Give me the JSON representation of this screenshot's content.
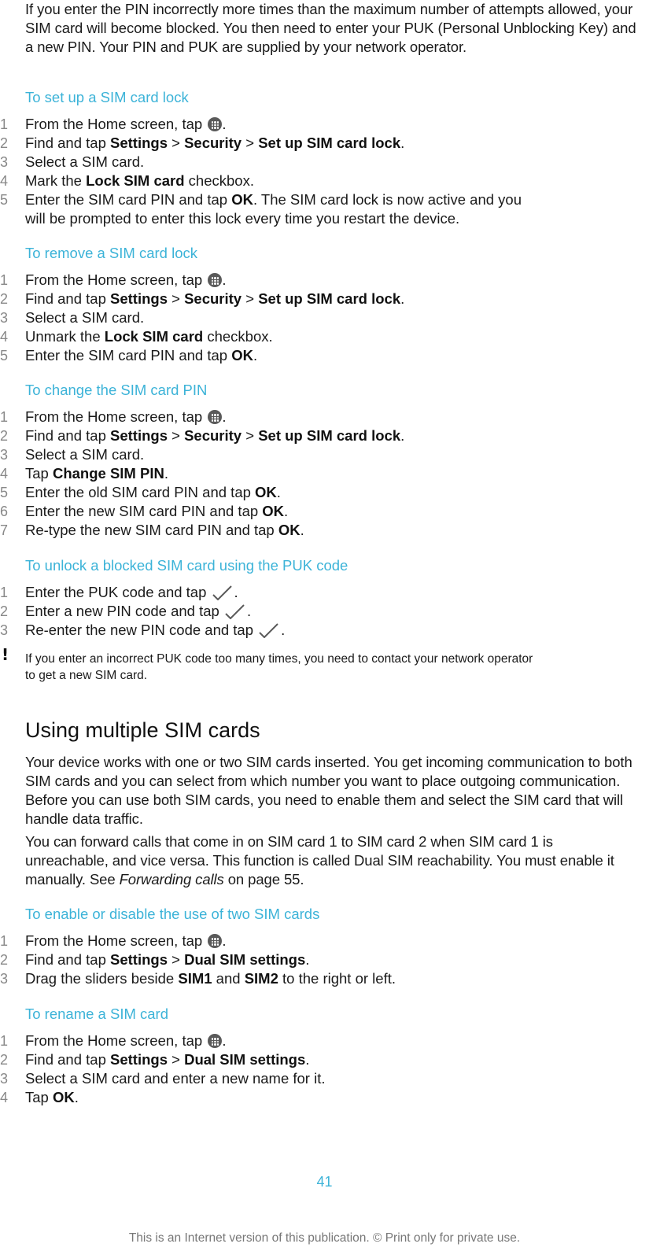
{
  "intro": "If you enter the PIN incorrectly more times than the maximum number of attempts allowed, your SIM card will become blocked. You then need to enter your PUK (Personal Unblocking Key) and a new PIN. Your PIN and PUK are supplied by your network operator.",
  "procedures": {
    "setup_lock": {
      "title": "To set up a SIM card lock",
      "steps": [
        {
          "num": "1",
          "pre": "From the Home screen, tap ",
          "icon": "app-screen-icon",
          "post": "."
        },
        {
          "num": "2",
          "pre": "Find and tap ",
          "b1": "Settings",
          "sep1": " > ",
          "b2": "Security",
          "sep2": " > ",
          "b3": "Set up SIM card lock",
          "post": "."
        },
        {
          "num": "3",
          "text": "Select a SIM card."
        },
        {
          "num": "4",
          "pre": "Mark the ",
          "b1": "Lock SIM card",
          "post": " checkbox."
        },
        {
          "num": "5",
          "pre": "Enter the SIM card PIN and tap ",
          "b1": "OK",
          "post": ". The SIM card lock is now active and you",
          "line2": "will be prompted to enter this lock every time you restart the device."
        }
      ]
    },
    "remove_lock": {
      "title": "To remove a SIM card lock",
      "steps": [
        {
          "num": "1",
          "pre": "From the Home screen, tap ",
          "icon": "app-screen-icon",
          "post": "."
        },
        {
          "num": "2",
          "pre": "Find and tap ",
          "b1": "Settings",
          "sep1": " > ",
          "b2": "Security",
          "sep2": " > ",
          "b3": "Set up SIM card lock",
          "post": "."
        },
        {
          "num": "3",
          "text": "Select a SIM card."
        },
        {
          "num": "4",
          "pre": "Unmark the ",
          "b1": "Lock SIM card",
          "post": " checkbox."
        },
        {
          "num": "5",
          "pre": "Enter the SIM card PIN and tap ",
          "b1": "OK",
          "post": "."
        }
      ]
    },
    "change_pin": {
      "title": "To change the SIM card PIN",
      "steps": [
        {
          "num": "1",
          "pre": "From the Home screen, tap ",
          "icon": "app-screen-icon",
          "post": "."
        },
        {
          "num": "2",
          "pre": "Find and tap ",
          "b1": "Settings",
          "sep1": " > ",
          "b2": "Security",
          "sep2": " > ",
          "b3": "Set up SIM card lock",
          "post": "."
        },
        {
          "num": "3",
          "text": "Select a SIM card."
        },
        {
          "num": "4",
          "pre": "Tap ",
          "b1": "Change SIM PIN",
          "post": "."
        },
        {
          "num": "5",
          "pre": "Enter the old SIM card PIN and tap ",
          "b1": "OK",
          "post": "."
        },
        {
          "num": "6",
          "pre": "Enter the new SIM card PIN and tap ",
          "b1": "OK",
          "post": "."
        },
        {
          "num": "7",
          "pre": "Re-type the new SIM card PIN and tap ",
          "b1": "OK",
          "post": "."
        }
      ]
    },
    "unlock_puk": {
      "title": "To unlock a blocked SIM card using the PUK code",
      "steps": [
        {
          "num": "1",
          "pre": "Enter the PUK code and tap ",
          "icon": "checkmark-icon",
          "post": "."
        },
        {
          "num": "2",
          "pre": "Enter a new PIN code and tap ",
          "icon": "checkmark-icon",
          "post": "."
        },
        {
          "num": "3",
          "pre": "Re-enter the new PIN code and tap ",
          "icon": "checkmark-icon",
          "post": "."
        }
      ]
    }
  },
  "note": {
    "icon": "!",
    "line1": "If you enter an incorrect PUK code too many times, you need to contact your network operator",
    "line2": "to get a new SIM card."
  },
  "section": {
    "heading": "Using multiple SIM cards",
    "para1": "Your device works with one or two SIM cards inserted. You get incoming communication to both SIM cards and you can select from which number you want to place outgoing communication. Before you can use both SIM cards, you need to enable them and select the SIM card that will handle data traffic.",
    "para2_pre": "You can forward calls that come in on SIM card 1 to SIM card 2 when SIM card 1 is unreachable, and vice versa. This function is called Dual SIM reachability. You must enable it manually. See ",
    "para2_link": "Forwarding calls",
    "para2_post": " on page 55."
  },
  "procedures2": {
    "enable_two": {
      "title": "To enable or disable the use of two SIM cards",
      "steps": [
        {
          "num": "1",
          "pre": "From the Home screen, tap ",
          "icon": "app-screen-icon",
          "post": "."
        },
        {
          "num": "2",
          "pre": "Find and tap ",
          "b1": "Settings",
          "sep1": " > ",
          "b2": "Dual SIM settings",
          "post": "."
        },
        {
          "num": "3",
          "pre": "Drag the sliders beside ",
          "b1": "SIM1",
          "mid": " and ",
          "b2": "SIM2",
          "post": " to the right or left."
        }
      ]
    },
    "rename": {
      "title": "To rename a SIM card",
      "steps": [
        {
          "num": "1",
          "pre": "From the Home screen, tap ",
          "icon": "app-screen-icon",
          "post": "."
        },
        {
          "num": "2",
          "pre": "Find and tap ",
          "b1": "Settings",
          "sep1": " > ",
          "b2": "Dual SIM settings",
          "post": "."
        },
        {
          "num": "3",
          "text": "Select a SIM card and enter a new name for it."
        },
        {
          "num": "4",
          "pre": "Tap ",
          "b1": "OK",
          "post": "."
        }
      ]
    }
  },
  "page_number": "41",
  "footer": "This is an Internet version of this publication. © Print only for private use.",
  "colors": {
    "accent": "#3cb3d8",
    "text": "#1a1a1a",
    "step_number": "#888888",
    "footer": "#777777"
  }
}
